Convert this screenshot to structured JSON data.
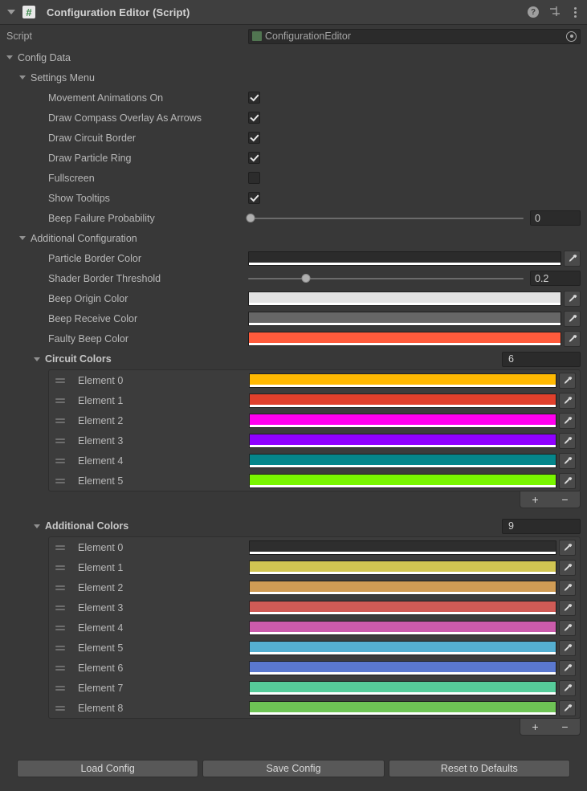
{
  "header": {
    "title": "Configuration Editor (Script)",
    "script_icon": "csharp-script-icon",
    "help_icon": "?",
    "preset_icon": "preset-slider-icon",
    "menu_icon": "kebab-menu-icon"
  },
  "script_row": {
    "label": "Script",
    "value": "ConfigurationEditor"
  },
  "config_data": {
    "label": "Config Data"
  },
  "settings_menu": {
    "label": "Settings Menu",
    "toggles": [
      {
        "label": "Movement Animations On",
        "checked": true
      },
      {
        "label": "Draw Compass Overlay As Arrows",
        "checked": true
      },
      {
        "label": "Draw Circuit Border",
        "checked": true
      },
      {
        "label": "Draw Particle Ring",
        "checked": true
      },
      {
        "label": "Fullscreen",
        "checked": false
      },
      {
        "label": "Show Tooltips",
        "checked": true
      }
    ],
    "beep_failure_probability": {
      "label": "Beep Failure Probability",
      "value": "0",
      "percent": 1
    }
  },
  "additional_configuration": {
    "label": "Additional Configuration",
    "particle_border_color": {
      "label": "Particle Border Color",
      "color": "#2b2b2b",
      "alpha": "#ffffff"
    },
    "shader_border_threshold": {
      "label": "Shader Border Threshold",
      "value": "0.2",
      "percent": 21
    },
    "beep_origin_color": {
      "label": "Beep Origin Color",
      "color": "#e2e2e2",
      "alpha": "#ffffff"
    },
    "beep_receive_color": {
      "label": "Beep Receive Color",
      "color": "#666666",
      "alpha": "#ffffff"
    },
    "faulty_beep_color": {
      "label": "Faulty Beep Color",
      "color": "#ff5b3c",
      "alpha": "#ffffff"
    }
  },
  "circuit_colors": {
    "label": "Circuit Colors",
    "size": "6",
    "elements": [
      {
        "label": "Element 0",
        "color": "#ffb902"
      },
      {
        "label": "Element 1",
        "color": "#e0402c"
      },
      {
        "label": "Element 2",
        "color": "#ff00ef"
      },
      {
        "label": "Element 3",
        "color": "#9000ff"
      },
      {
        "label": "Element 4",
        "color": "#05868b"
      },
      {
        "label": "Element 5",
        "color": "#79f600"
      }
    ],
    "add_label": "+",
    "remove_label": "−"
  },
  "additional_colors": {
    "label": "Additional Colors",
    "size": "9",
    "elements": [
      {
        "label": "Element 0",
        "color": "#2e2e2e"
      },
      {
        "label": "Element 1",
        "color": "#d1c552"
      },
      {
        "label": "Element 2",
        "color": "#d09c55"
      },
      {
        "label": "Element 3",
        "color": "#cf5b56"
      },
      {
        "label": "Element 4",
        "color": "#cb5bab"
      },
      {
        "label": "Element 5",
        "color": "#55afd1"
      },
      {
        "label": "Element 6",
        "color": "#5a78cf"
      },
      {
        "label": "Element 7",
        "color": "#56cc9a"
      },
      {
        "label": "Element 8",
        "color": "#6ec455"
      }
    ],
    "add_label": "+",
    "remove_label": "−"
  },
  "buttons": {
    "load": "Load Config",
    "save": "Save Config",
    "reset": "Reset to Defaults"
  }
}
